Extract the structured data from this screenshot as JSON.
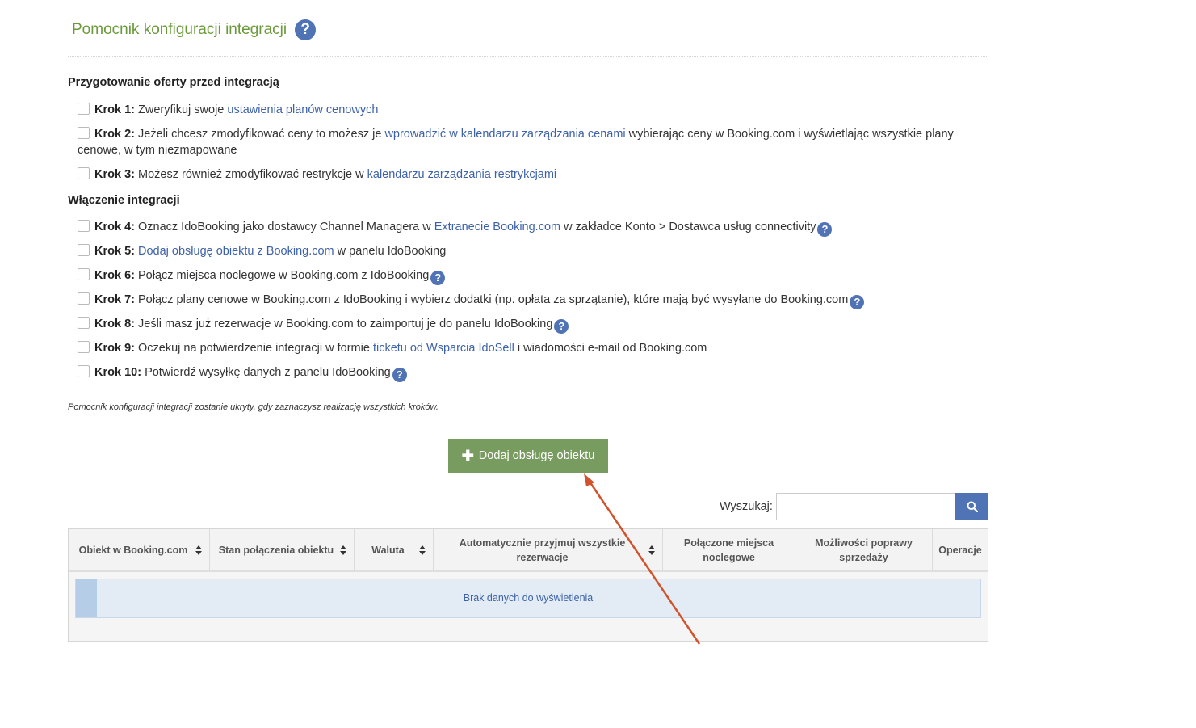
{
  "page": {
    "title": "Pomocnik konfiguracji integracji"
  },
  "sections": {
    "preparation": "Przygotowanie oferty przed integracją",
    "enabling": "Włączenie integracji"
  },
  "steps": [
    {
      "label": "Krok 1:",
      "pre": "Zweryfikuj swoje",
      "link": "ustawienia planów cenowych",
      "post": ""
    },
    {
      "label": "Krok 2:",
      "pre": "Jeżeli chcesz zmodyfikować ceny to możesz je",
      "link": "wprowadzić w kalendarzu zarządzania cenami",
      "post": "wybierając ceny w Booking.com i wyświetlając wszystkie plany cenowe, w tym niezmapowane"
    },
    {
      "label": "Krok 3:",
      "pre": "Możesz również zmodyfikować restrykcje w",
      "link": "kalendarzu zarządzania restrykcjami",
      "post": ""
    },
    {
      "label": "Krok 4:",
      "pre": "Oznacz IdoBooking jako dostawcy Channel Managera w",
      "link": "Extranecie Booking.com",
      "post": "w zakładce Konto > Dostawca usług connectivity"
    },
    {
      "label": "Krok 5:",
      "pre": "",
      "link": "Dodaj obsługę obiektu z Booking.com",
      "post": "w panelu IdoBooking"
    },
    {
      "label": "Krok 6:",
      "pre": "Połącz miejsca noclegowe w Booking.com z IdoBooking",
      "link": "",
      "post": ""
    },
    {
      "label": "Krok 7:",
      "pre": "Połącz plany cenowe w Booking.com z IdoBooking i wybierz dodatki (np. opłata za sprzątanie), które mają być wysyłane do Booking.com",
      "link": "",
      "post": ""
    },
    {
      "label": "Krok 8:",
      "pre": "Jeśli masz już rezerwacje w Booking.com to zaimportuj je do panelu IdoBooking",
      "link": "",
      "post": ""
    },
    {
      "label": "Krok 9:",
      "pre": "Oczekuj na potwierdzenie integracji w formie",
      "link": "ticketu od Wsparcia IdoSell",
      "post": "i wiadomości e-mail od Booking.com"
    },
    {
      "label": "Krok 10:",
      "pre": "Potwierdź wysyłkę danych z panelu IdoBooking",
      "link": "",
      "post": ""
    }
  ],
  "note": "Pomocnik konfiguracji integracji zostanie ukryty, gdy zaznaczysz realizację wszystkich kroków.",
  "add_button": {
    "icon": "plus-icon",
    "label": "Dodaj obsługę obiektu"
  },
  "search": {
    "label": "Wyszukaj:",
    "value": "",
    "icon": "search-icon"
  },
  "table": {
    "columns": [
      "Obiekt w Booking.com",
      "Stan połączenia obiektu",
      "Waluta",
      "Automatycznie przyjmuj wszystkie rezerwacje",
      "Połączone miejsca noclegowe",
      "Możliwości poprawy sprzedaży",
      "Operacje"
    ],
    "empty_message": "Brak danych do wyświetlenia"
  },
  "colors": {
    "title_green": "#6a9a3a",
    "link_blue": "#3d62a8",
    "button_green": "#789b5f",
    "help_blue": "#4f73b4",
    "annotation_arrow": "#d2522c"
  }
}
